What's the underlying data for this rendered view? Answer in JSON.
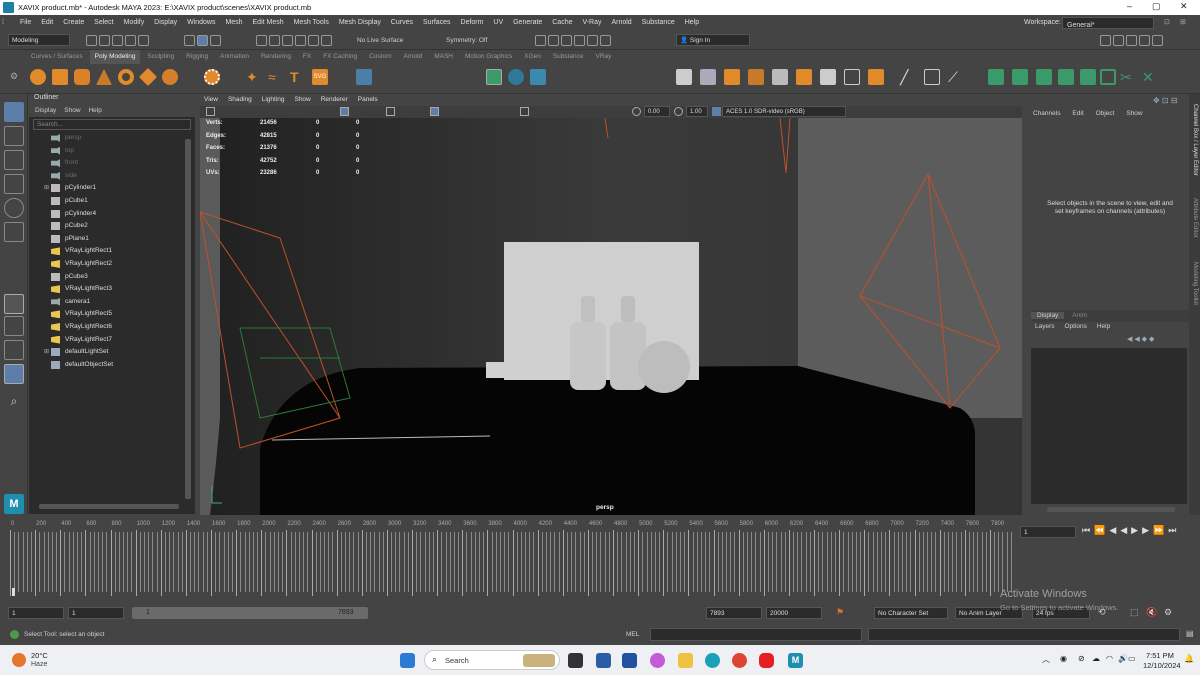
{
  "window": {
    "title": "XAVIX product.mb* - Autodesk MAYA 2023: E:\\XAVIX product\\scenes\\XAVIX product.mb"
  },
  "menubar": [
    "File",
    "Edit",
    "Create",
    "Select",
    "Modify",
    "Display",
    "Windows",
    "Mesh",
    "Edit Mesh",
    "Mesh Tools",
    "Mesh Display",
    "Curves",
    "Surfaces",
    "Deform",
    "UV",
    "Generate",
    "Cache",
    "V-Ray",
    "Arnold",
    "Substance",
    "Help"
  ],
  "workspace": {
    "label": "Workspace:",
    "value": "General*"
  },
  "statusline": {
    "mode": "Modeling",
    "live_surface": "No Live Surface",
    "symmetry": "Symmetry: Off",
    "signin": "Sign In"
  },
  "shelf_tabs": [
    "Curves / Surfaces",
    "Poly Modeling",
    "Sculpting",
    "Rigging",
    "Animation",
    "Rendering",
    "FX",
    "FX Caching",
    "Custom",
    "Arnold",
    "MASH",
    "Motion Graphics",
    "XGen",
    "Substance",
    "VRay"
  ],
  "shelf_active": "Poly Modeling",
  "outliner": {
    "title": "Outliner",
    "menu": [
      "Display",
      "Show",
      "Help"
    ],
    "search_placeholder": "Search...",
    "items": [
      {
        "label": "persp",
        "icon": "camera",
        "dim": true,
        "expand": false
      },
      {
        "label": "top",
        "icon": "camera",
        "dim": true,
        "expand": false
      },
      {
        "label": "front",
        "icon": "camera",
        "dim": true,
        "expand": false
      },
      {
        "label": "side",
        "icon": "camera",
        "dim": true,
        "expand": false
      },
      {
        "label": "pCylinder1",
        "icon": "mesh",
        "dim": false,
        "expand": true
      },
      {
        "label": "pCube1",
        "icon": "mesh",
        "dim": false,
        "expand": false
      },
      {
        "label": "pCylinder4",
        "icon": "mesh",
        "dim": false,
        "expand": false
      },
      {
        "label": "pCube2",
        "icon": "mesh",
        "dim": false,
        "expand": false
      },
      {
        "label": "pPlane1",
        "icon": "mesh",
        "dim": false,
        "expand": false
      },
      {
        "label": "VRayLightRect1",
        "icon": "light",
        "dim": false,
        "expand": false
      },
      {
        "label": "VRayLightRect2",
        "icon": "light",
        "dim": false,
        "expand": false
      },
      {
        "label": "pCube3",
        "icon": "mesh",
        "dim": false,
        "expand": false
      },
      {
        "label": "VRayLightRect3",
        "icon": "light",
        "dim": false,
        "expand": false
      },
      {
        "label": "camera1",
        "icon": "camera",
        "dim": false,
        "expand": false
      },
      {
        "label": "VRayLightRect5",
        "icon": "light",
        "dim": false,
        "expand": false
      },
      {
        "label": "VRayLightRect6",
        "icon": "light",
        "dim": false,
        "expand": false
      },
      {
        "label": "VRayLightRect7",
        "icon": "light",
        "dim": false,
        "expand": false
      },
      {
        "label": "defaultLightSet",
        "icon": "set",
        "dim": false,
        "expand": true
      },
      {
        "label": "defaultObjectSet",
        "icon": "set",
        "dim": false,
        "expand": false
      }
    ]
  },
  "viewport": {
    "menu": [
      "View",
      "Shading",
      "Lighting",
      "Show",
      "Renderer",
      "Panels"
    ],
    "exposure": "0.00",
    "gamma": "1.00",
    "colorspace": "ACES 1.0 SDR-video (sRGB)",
    "camera_label": "persp",
    "hud": [
      {
        "label": "Verts:",
        "a": "21456",
        "b": "0",
        "c": "0"
      },
      {
        "label": "Edges:",
        "a": "42815",
        "b": "0",
        "c": "0"
      },
      {
        "label": "Faces:",
        "a": "21376",
        "b": "0",
        "c": "0"
      },
      {
        "label": "Tris:",
        "a": "42752",
        "b": "0",
        "c": "0"
      },
      {
        "label": "UVs:",
        "a": "23286",
        "b": "0",
        "c": "0"
      }
    ]
  },
  "channelbox": {
    "menu": [
      "Channels",
      "Edit",
      "Object",
      "Show"
    ],
    "hint": "Select objects in the scene to view, edit and set keyframes on channels (attributes)",
    "layer_tabs": [
      "Display",
      "Anim"
    ],
    "layer_menu": [
      "Layers",
      "Options",
      "Help"
    ]
  },
  "side_tabs": [
    "Channel Box / Layer Editor",
    "Attribute Editor",
    "Modeling Toolkit"
  ],
  "timeline": {
    "ticks": [
      "0",
      "200",
      "400",
      "600",
      "800",
      "1000",
      "1200",
      "1400",
      "1600",
      "1800",
      "2000",
      "2200",
      "2400",
      "2600",
      "2800",
      "3000",
      "3200",
      "3400",
      "3600",
      "3800",
      "4000",
      "4200",
      "4400",
      "4600",
      "4800",
      "5000",
      "5200",
      "5400",
      "5600",
      "5800",
      "6000",
      "6200",
      "6400",
      "6600",
      "6800",
      "7000",
      "7200",
      "7400",
      "7600",
      "7800"
    ],
    "current_frame": "1"
  },
  "range": {
    "start": "1",
    "playback_start": "1",
    "slider_start": "1",
    "slider_end": "7893",
    "end": "7893",
    "anim_end": "20000",
    "character_set": "No Character Set",
    "anim_layer": "No Anim Layer",
    "fps": "24 fps"
  },
  "activate_windows": {
    "title": "Activate Windows",
    "sub": "Go to Settings to activate Windows."
  },
  "status": {
    "help": "Select Tool: select an object",
    "mel": "MEL"
  },
  "taskbar": {
    "weather_temp": "20°C",
    "weather_cond": "Haze",
    "search": "Search",
    "time": "7:51 PM",
    "date": "12/10/2024"
  }
}
